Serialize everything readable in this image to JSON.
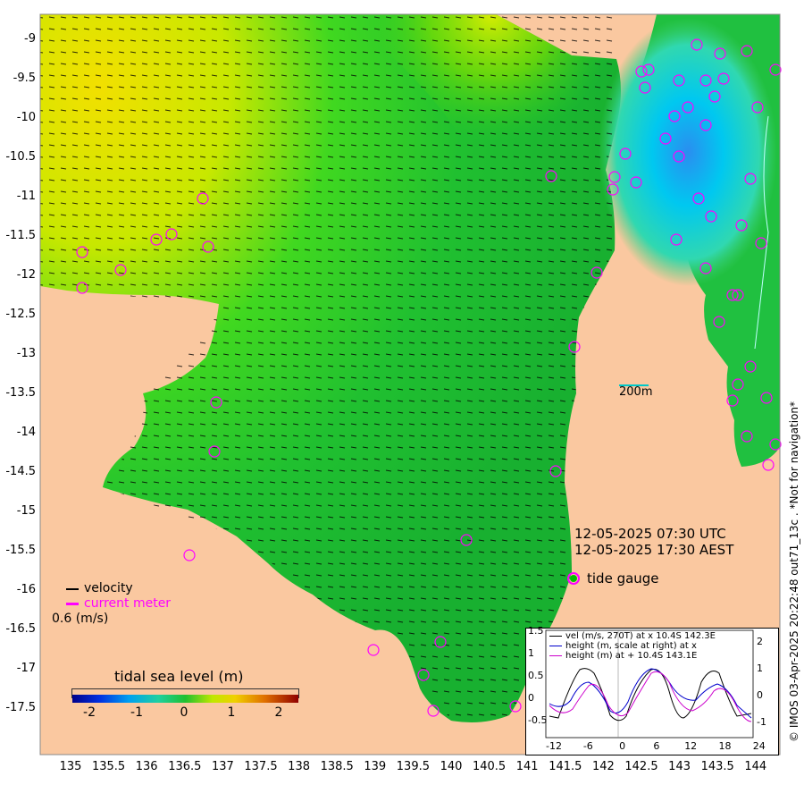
{
  "map": {
    "y_axis_labels": [
      "-9",
      "-9.5",
      "-10",
      "-10.5",
      "-11",
      "-11.5",
      "-12",
      "-12.5",
      "-13",
      "-13.5",
      "-14",
      "-14.5",
      "-15",
      "-15.5",
      "-16",
      "-16.5",
      "-17",
      "-17.5"
    ],
    "x_axis_labels": [
      "135",
      "135.5",
      "136",
      "136.5",
      "137",
      "137.5",
      "138",
      "138.5",
      "139",
      "139.5",
      "140",
      "140.5",
      "141",
      "141.5",
      "142",
      "142.5",
      "143",
      "143.5",
      "144"
    ],
    "colors": {
      "land": "#fac8a0",
      "sea_mid": "#20c020",
      "sea_high": "#f0e000",
      "sea_low": "#00b8ff",
      "gauge": "#ff00ff"
    },
    "scale_bar_label": "200m",
    "timestamp_utc": "12-05-2025 07:30 UTC",
    "timestamp_aest": "12-05-2025 17:30 AEST",
    "tide_gauge_label": "tide gauge",
    "velocity_label": "velocity",
    "current_meter_label": "current meter",
    "velocity_scale": "0.6 (m/s)",
    "colorbar_title": "tidal sea level (m)",
    "colorbar_ticks": [
      "-2",
      "-1",
      "0",
      "1",
      "2"
    ],
    "copyright": "© IMOS 03-Apr-2025 20:22:48 out71_13c . *Not for navigation*"
  },
  "inset": {
    "legend": [
      "vel (m/s, 270T) at x 10.4S 142.3E",
      "height (m, scale at right) at x",
      "height (m) at + 10.4S 143.1E"
    ],
    "legend_colors": [
      "#000000",
      "#0000cc",
      "#cc00cc"
    ],
    "y_left_labels": [
      "1.5",
      "1",
      "0.5",
      "0",
      "-0.5"
    ],
    "y_right_labels": [
      "2",
      "1",
      "0",
      "-1"
    ],
    "x_labels": [
      "-12",
      "-6",
      "0",
      "6",
      "12",
      "18",
      "24"
    ]
  }
}
